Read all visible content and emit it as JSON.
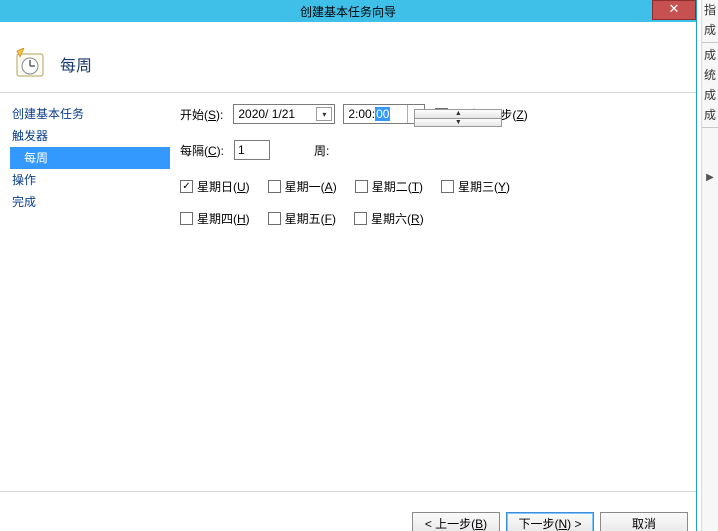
{
  "window": {
    "title": "创建基本任务向导"
  },
  "header": {
    "page_title": "每周"
  },
  "sidebar": {
    "items": [
      {
        "label": "创建基本任务",
        "sub": false,
        "selected": false
      },
      {
        "label": "触发器",
        "sub": false,
        "selected": false
      },
      {
        "label": "每周",
        "sub": true,
        "selected": true
      },
      {
        "label": "操作",
        "sub": false,
        "selected": false
      },
      {
        "label": "完成",
        "sub": false,
        "selected": false
      }
    ]
  },
  "form": {
    "start_label_pre": "开始(",
    "start_label_key": "S",
    "start_label_post": "):",
    "date_value": "2020/ 1/21",
    "time_prefix": "2:00:",
    "time_selected": "00",
    "tz_label_pre": "跨时区同步(",
    "tz_label_key": "Z",
    "tz_label_post": ")",
    "tz_checked": false,
    "interval_label_pre": "每隔(",
    "interval_label_key": "C",
    "interval_label_post": "):",
    "interval_value": "1",
    "interval_unit": "周:",
    "days": [
      {
        "pre": "星期日(",
        "key": "U",
        "post": ")",
        "checked": true
      },
      {
        "pre": "星期一(",
        "key": "A",
        "post": ")",
        "checked": false
      },
      {
        "pre": "星期二(",
        "key": "T",
        "post": ")",
        "checked": false
      },
      {
        "pre": "星期三(",
        "key": "Y",
        "post": ")",
        "checked": false
      },
      {
        "pre": "星期四(",
        "key": "H",
        "post": ")",
        "checked": false
      },
      {
        "pre": "星期五(",
        "key": "F",
        "post": ")",
        "checked": false
      },
      {
        "pre": "星期六(",
        "key": "R",
        "post": ")",
        "checked": false
      }
    ]
  },
  "footer": {
    "back_pre": "< 上一步(",
    "back_key": "B",
    "back_post": ")",
    "next_pre": "下一步(",
    "next_key": "N",
    "next_post": ") >",
    "cancel": "取消"
  },
  "bg_chars": [
    "指",
    "成",
    "成",
    "统",
    "成",
    "成"
  ]
}
